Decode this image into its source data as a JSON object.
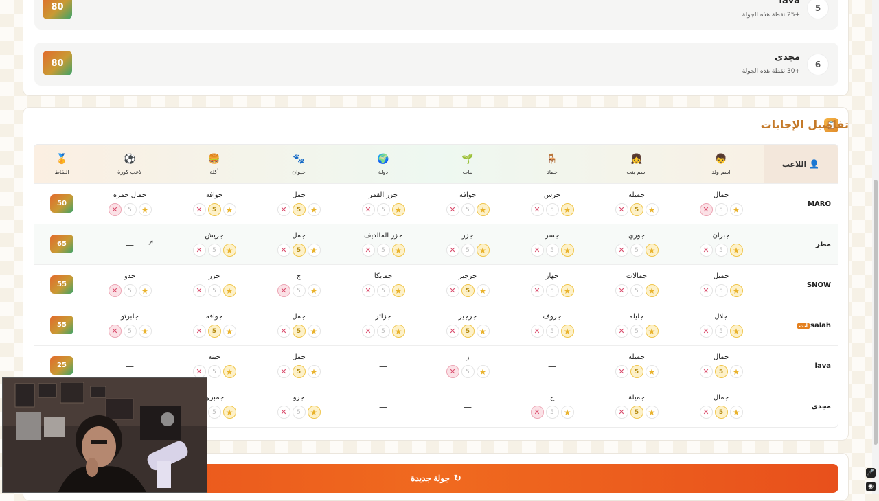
{
  "leaderboard": [
    {
      "rank": "5",
      "name": "lava",
      "sub": "+25 نقطة هذه الجولة",
      "score": "80",
      "top": 0
    },
    {
      "rank": "6",
      "name": "مجدى",
      "sub": "+30 نقطة هذه الجولة",
      "score": "80",
      "top": 0
    }
  ],
  "answers": {
    "title": "تفاصيل الإجابات",
    "title_icon": "clipboard-icon",
    "player_header": "اللاعب",
    "columns": [
      {
        "label": "اسم ولد",
        "icon": "boy-icon",
        "glyph": "👦"
      },
      {
        "label": "اسم بنت",
        "icon": "girl-icon",
        "glyph": "👧"
      },
      {
        "label": "جماد",
        "icon": "chair-icon",
        "glyph": "🪑"
      },
      {
        "label": "نبات",
        "icon": "plant-icon",
        "glyph": "🌱"
      },
      {
        "label": "دولة",
        "icon": "globe-icon",
        "glyph": "🌍"
      },
      {
        "label": "حيوان",
        "icon": "paw-icon",
        "glyph": "🐾"
      },
      {
        "label": "أكلة",
        "icon": "burger-icon",
        "glyph": "🍔"
      },
      {
        "label": "لاعب كورة",
        "icon": "football-icon",
        "glyph": "⚽"
      },
      {
        "label": "النقاط",
        "icon": "medal-icon",
        "glyph": "🏅"
      }
    ],
    "five_label": "5",
    "rows": [
      {
        "name": "MARO",
        "you": false,
        "score": "50",
        "cells": [
          {
            "w": "جمال",
            "s": 0
          },
          {
            "w": "جميله",
            "s": 5
          },
          {
            "w": "جرس",
            "s": 10
          },
          {
            "w": "جوافه",
            "s": 10
          },
          {
            "w": "جزر القمر",
            "s": 10
          },
          {
            "w": "جمل",
            "s": 5
          },
          {
            "w": "جوافه",
            "s": 5
          },
          {
            "w": "جمال حمزه",
            "s": 0
          }
        ]
      },
      {
        "name": "مطر",
        "you": false,
        "score": "65",
        "cells": [
          {
            "w": "جبران",
            "s": 10
          },
          {
            "w": "جوري",
            "s": 10
          },
          {
            "w": "جسر",
            "s": 10
          },
          {
            "w": "جزر",
            "s": 10
          },
          {
            "w": "جزر المالديف",
            "s": 10
          },
          {
            "w": "جمل",
            "s": 5
          },
          {
            "w": "جريش",
            "s": 10
          },
          {
            "w": "",
            "s": -1
          }
        ]
      },
      {
        "name": "SNOW",
        "you": false,
        "score": "55",
        "cells": [
          {
            "w": "جميل",
            "s": 10
          },
          {
            "w": "جمالات",
            "s": 10
          },
          {
            "w": "جهاز",
            "s": 10
          },
          {
            "w": "جرجير",
            "s": 5
          },
          {
            "w": "جمايكا",
            "s": 10
          },
          {
            "w": "ج",
            "s": 0
          },
          {
            "w": "جزر",
            "s": 10
          },
          {
            "w": "جدو",
            "s": 0
          }
        ]
      },
      {
        "name": "salah",
        "you": true,
        "you_label": "أنت",
        "score": "55",
        "cells": [
          {
            "w": "جلال",
            "s": 10
          },
          {
            "w": "جليله",
            "s": 10
          },
          {
            "w": "جروف",
            "s": 10
          },
          {
            "w": "جرجير",
            "s": 5
          },
          {
            "w": "جزائر",
            "s": 10
          },
          {
            "w": "جمل",
            "s": 5
          },
          {
            "w": "جوافه",
            "s": 5
          },
          {
            "w": "جلبرتو",
            "s": 0
          }
        ]
      },
      {
        "name": "lava",
        "you": false,
        "score": "25",
        "cells": [
          {
            "w": "جمال",
            "s": 5
          },
          {
            "w": "جميله",
            "s": 5
          },
          {
            "w": "",
            "s": -1
          },
          {
            "w": "ز",
            "s": 0
          },
          {
            "w": "",
            "s": -1
          },
          {
            "w": "جمل",
            "s": 5
          },
          {
            "w": "جبنه",
            "s": 10
          },
          {
            "w": "",
            "s": -1
          }
        ]
      },
      {
        "name": "مجدى",
        "you": false,
        "score": "",
        "cells": [
          {
            "w": "جمال",
            "s": 5
          },
          {
            "w": "جميلة",
            "s": 5
          },
          {
            "w": "ج",
            "s": 0
          },
          {
            "w": "",
            "s": -1
          },
          {
            "w": "",
            "s": -1
          },
          {
            "w": "جرو",
            "s": 10
          },
          {
            "w": "جمبري",
            "s": 10
          },
          {
            "w": "",
            "s": -1
          }
        ]
      }
    ]
  },
  "new_round": {
    "label": "جولة جديدة",
    "icon": "refresh-icon"
  },
  "colors": {
    "accent": "#e8501c",
    "title": "#c47a2a",
    "star": "#e9b22c",
    "reject": "#d94a6b"
  },
  "dash": "—"
}
